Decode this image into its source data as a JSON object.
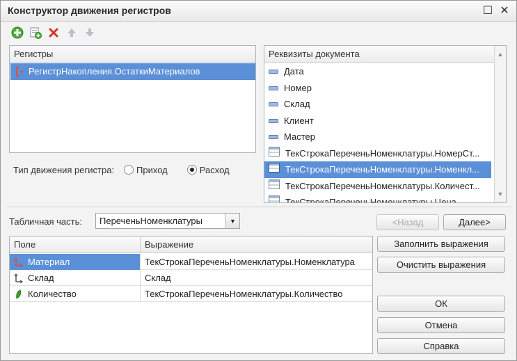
{
  "window": {
    "title": "Конструктор движения регистров"
  },
  "title_buttons": {
    "maximize_glyph": "☐",
    "close_glyph": "✕"
  },
  "toolbar": {
    "icons": [
      "add-icon",
      "add-copy-icon",
      "delete-icon",
      "move-up-icon",
      "move-down-icon"
    ]
  },
  "registers": {
    "header": "Регистры",
    "items": [
      {
        "label": "РегистрНакопления.ОстаткиМатериалов"
      }
    ]
  },
  "attributes": {
    "header": "Реквизиты документа",
    "items": [
      {
        "label": "Дата"
      },
      {
        "label": "Номер"
      },
      {
        "label": "Склад"
      },
      {
        "label": "Клиент"
      },
      {
        "label": "Мастер"
      },
      {
        "label": "ТекСтрокаПереченьНоменклатуры.НомерСт..."
      },
      {
        "label": "ТекСтрокаПереченьНоменклатуры.Номенкл..."
      },
      {
        "label": "ТекСтрокаПереченьНоменклатуры.Количест..."
      },
      {
        "label": "ТекСтрокаПереченьНоменклатуры.Цена"
      }
    ],
    "selected_index": 6
  },
  "movement_type": {
    "label": "Тип движения регистра:",
    "options": [
      "Приход",
      "Расход"
    ],
    "selected": "Расход"
  },
  "tabular_part": {
    "label": "Табличная часть:",
    "value": "ПереченьНоменклатуры"
  },
  "buttons": {
    "back": "<Назад",
    "next": "Далее>",
    "fill": "Заполнить выражения",
    "clear": "Очистить выражения",
    "ok": "ОК",
    "cancel": "Отмена",
    "help": "Справка"
  },
  "grid": {
    "columns": [
      "Поле",
      "Выражение"
    ],
    "rows": [
      {
        "field": "Материал",
        "expression": "ТекСтрокаПереченьНоменклатуры.Номенклатура",
        "icon": "dimension-icon"
      },
      {
        "field": "Склад",
        "expression": "Склад",
        "icon": "dimension-icon"
      },
      {
        "field": "Количество",
        "expression": "ТекСтрокаПереченьНоменклатуры.Количество",
        "icon": "resource-icon"
      }
    ],
    "selected_index": 0
  },
  "colors": {
    "selection": "#5b8fd7",
    "border": "#a9b4c2"
  }
}
